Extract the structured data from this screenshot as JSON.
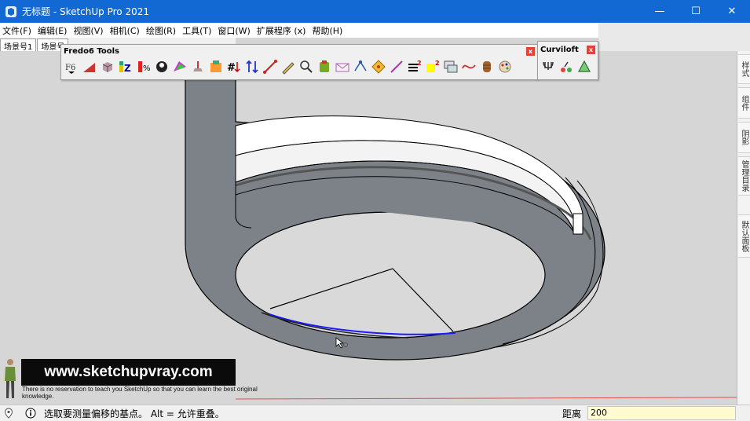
{
  "window": {
    "title": "无标题 - SketchUp Pro 2021",
    "minimize_glyph": "—",
    "maximize_glyph": "☐",
    "close_glyph": "✕"
  },
  "menu": [
    "文件(F)",
    "编辑(E)",
    "视图(V)",
    "相机(C)",
    "绘图(R)",
    "工具(T)",
    "窗口(W)",
    "扩展程序 (x)",
    "帮助(H)"
  ],
  "scenes": [
    "场景号1",
    "场景号"
  ],
  "toolbars": {
    "fredo": {
      "title": "Fredo6 Tools",
      "close": "x"
    },
    "curviloft": {
      "title": "Curviloft",
      "close": "x"
    }
  },
  "tray_tabs": [
    "样式",
    "组件",
    "阴影",
    "管理目录",
    "默认面板"
  ],
  "watermark": {
    "site": "www.sketchupvray.com",
    "tagline": "There is no reservation to teach you SketchUp so that you can learn the best original knowledge."
  },
  "status": {
    "message": "选取要测量偏移的基点。 Alt = 允许重叠。",
    "measure_label": "距离",
    "measure_value": "200"
  },
  "colors": {
    "titlebar": "#1269d3",
    "model_gray": "#7a8086",
    "selection_blue": "#1a1aff",
    "background": "#d6d6d6"
  }
}
